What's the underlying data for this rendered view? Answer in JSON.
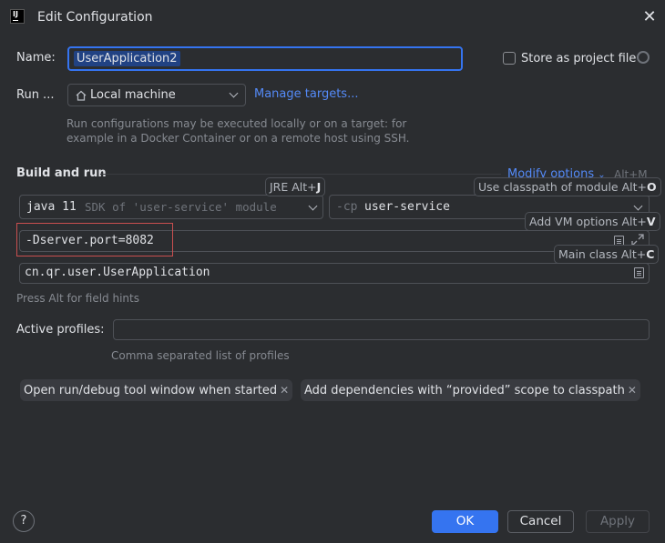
{
  "window": {
    "title": "Edit Configuration",
    "app_icon_text": "IJ"
  },
  "name_row": {
    "label": "Name:",
    "value": "UserApplication2"
  },
  "store_project": {
    "label": "Store as project file",
    "checked": false
  },
  "run_on": {
    "label": "Run ...",
    "target": "Local machine",
    "manage_link": "Manage targets...",
    "hint_line1": "Run configurations may be executed locally or on a target: for",
    "hint_line2": "example in a Docker Container or on a remote host using SSH."
  },
  "build_and_run": {
    "heading": "Build and run",
    "modify_options": "Modify options",
    "modify_shortcut": "Alt+M",
    "jre": {
      "main": "java 11",
      "sub": "SDK of 'user-service' module"
    },
    "classpath": {
      "prefix": "-cp",
      "module": "user-service"
    },
    "vm_options": "-Dserver.port=8082",
    "main_class": "cn.qr.user.UserApplication",
    "field_hint": "Press Alt for field hints",
    "tooltips": {
      "jre": {
        "text": "JRE Alt+",
        "key": "J"
      },
      "classpath": {
        "text": "Use classpath of module Alt+",
        "key": "O"
      },
      "vm": {
        "text": "Add VM options Alt+",
        "key": "V"
      },
      "main_class": {
        "text": "Main class Alt+",
        "key": "C"
      }
    }
  },
  "profiles": {
    "label": "Active profiles:",
    "value": "",
    "hint": "Comma separated list of profiles"
  },
  "chips": [
    {
      "label": "Open run/debug tool window when started"
    },
    {
      "label": "Add dependencies with “provided” scope to classpath"
    }
  ],
  "buttons": {
    "help": "?",
    "ok": "OK",
    "cancel": "Cancel",
    "apply": "Apply"
  },
  "colors": {
    "background": "#2b2d30",
    "accent": "#3574f0",
    "link": "#548af7",
    "highlight_box": "#c94f4f"
  }
}
